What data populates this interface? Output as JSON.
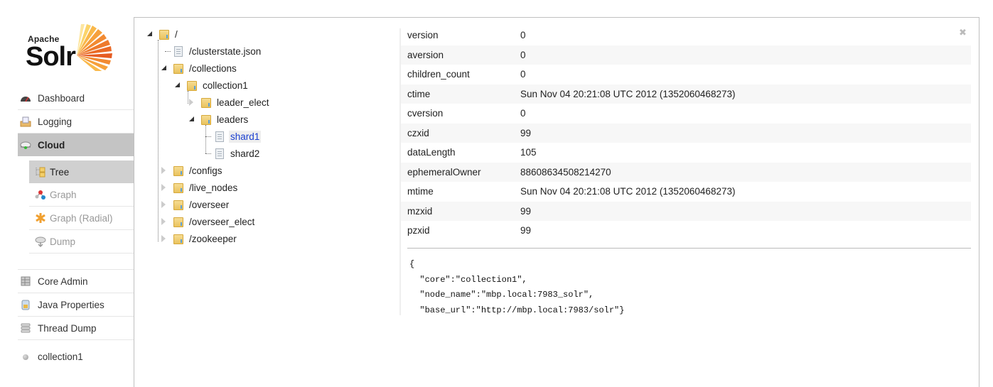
{
  "logo": {
    "line1": "Apache",
    "line2": "Solr"
  },
  "sidebar": {
    "items": [
      {
        "label": "Dashboard",
        "icon": "dashboard-icon"
      },
      {
        "label": "Logging",
        "icon": "logging-icon"
      },
      {
        "label": "Cloud",
        "icon": "cloud-icon",
        "active": true
      },
      {
        "label": "Core Admin",
        "icon": "core-admin-icon"
      },
      {
        "label": "Java Properties",
        "icon": "java-properties-icon"
      },
      {
        "label": "Thread Dump",
        "icon": "thread-dump-icon"
      }
    ],
    "cloud_sub": [
      {
        "label": "Tree",
        "icon": "tree-icon",
        "active": true
      },
      {
        "label": "Graph",
        "icon": "graph-icon"
      },
      {
        "label": "Graph (Radial)",
        "icon": "graph-radial-icon"
      },
      {
        "label": "Dump",
        "icon": "dump-icon"
      }
    ],
    "core_selector": "collection1"
  },
  "tree": {
    "nodes": [
      {
        "label": "/",
        "type": "folder",
        "state": "open"
      },
      {
        "label": "/clusterstate.json",
        "type": "file"
      },
      {
        "label": "/collections",
        "type": "folder",
        "state": "open"
      },
      {
        "label": "collection1",
        "type": "folder",
        "state": "open"
      },
      {
        "label": "leader_elect",
        "type": "folder",
        "state": "closed"
      },
      {
        "label": "leaders",
        "type": "folder",
        "state": "open"
      },
      {
        "label": "shard1",
        "type": "file",
        "selected": true
      },
      {
        "label": "shard2",
        "type": "file"
      },
      {
        "label": "/configs",
        "type": "folder",
        "state": "closed"
      },
      {
        "label": "/live_nodes",
        "type": "folder",
        "state": "closed"
      },
      {
        "label": "/overseer",
        "type": "folder",
        "state": "closed"
      },
      {
        "label": "/overseer_elect",
        "type": "folder",
        "state": "closed"
      },
      {
        "label": "/zookeeper",
        "type": "folder",
        "state": "closed"
      }
    ]
  },
  "detail": {
    "close_icon": "close-icon",
    "properties": [
      {
        "key": "version",
        "value": "0"
      },
      {
        "key": "aversion",
        "value": "0"
      },
      {
        "key": "children_count",
        "value": "0"
      },
      {
        "key": "ctime",
        "value": "Sun Nov 04 20:21:08 UTC 2012 (1352060468273)"
      },
      {
        "key": "cversion",
        "value": "0"
      },
      {
        "key": "czxid",
        "value": "99"
      },
      {
        "key": "dataLength",
        "value": "105"
      },
      {
        "key": "ephemeralOwner",
        "value": "88608634508214270"
      },
      {
        "key": "mtime",
        "value": "Sun Nov 04 20:21:08 UTC 2012 (1352060468273)"
      },
      {
        "key": "mzxid",
        "value": "99"
      },
      {
        "key": "pzxid",
        "value": "99"
      }
    ],
    "content": "{\n  \"core\":\"collection1\",\n  \"node_name\":\"mbp.local:7983_solr\",\n  \"base_url\":\"http://mbp.local:7983/solr\"}"
  }
}
